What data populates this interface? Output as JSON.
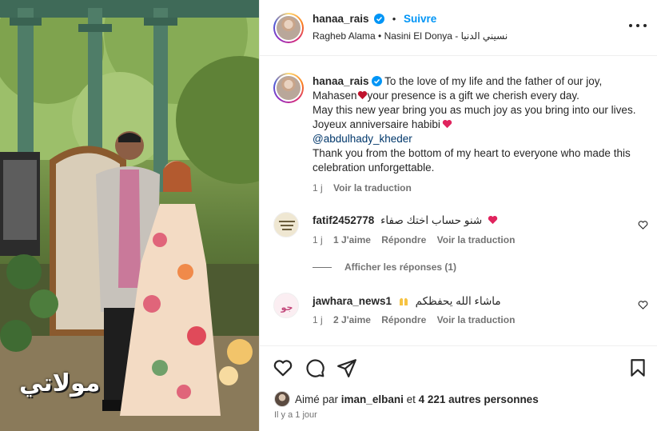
{
  "watermark": "مولاتي",
  "post": {
    "username": "hanaa_rais",
    "follow_label": "Suivre",
    "music": "Ragheb Alama • Nasini El Donya - نسيني الدنيا"
  },
  "caption": {
    "username": "hanaa_rais",
    "line1": "To the love of my life and the father of our joy,",
    "line2a": "Mahasen",
    "line2b": "your presence is a gift we cherish every day.",
    "line3": "May this new year bring you as much joy as you bring into our lives.",
    "line4": "Joyeux anniversaire habibi",
    "mention": "@abdulhady_kheder",
    "line5": "Thank you from the bottom of my heart to everyone who made this celebration unforgettable.",
    "time": "1 j",
    "translate": "Voir la traduction"
  },
  "comments": [
    {
      "username": "fatif2452778",
      "text": "شنو حساب اختك صفاء",
      "time": "1 j",
      "likes": "1 J'aime",
      "reply": "Répondre",
      "translate": "Voir la traduction"
    },
    {
      "username": "jawhara_news1",
      "text": "ماشاء الله يحفظكم",
      "time": "1 j",
      "likes": "2 J'aime",
      "reply": "Répondre",
      "translate": "Voir la traduction"
    }
  ],
  "view_replies": "Afficher les réponses (1)",
  "liked_by": {
    "prefix": "Aimé par",
    "user": "iman_elbani",
    "middle": "et",
    "others": "4 221 autres personnes"
  },
  "posted_ago": "Il y a 1 jour",
  "colors": {
    "accent": "#0095f6",
    "heart_emoji": "#e0245e",
    "muted": "#737373"
  }
}
